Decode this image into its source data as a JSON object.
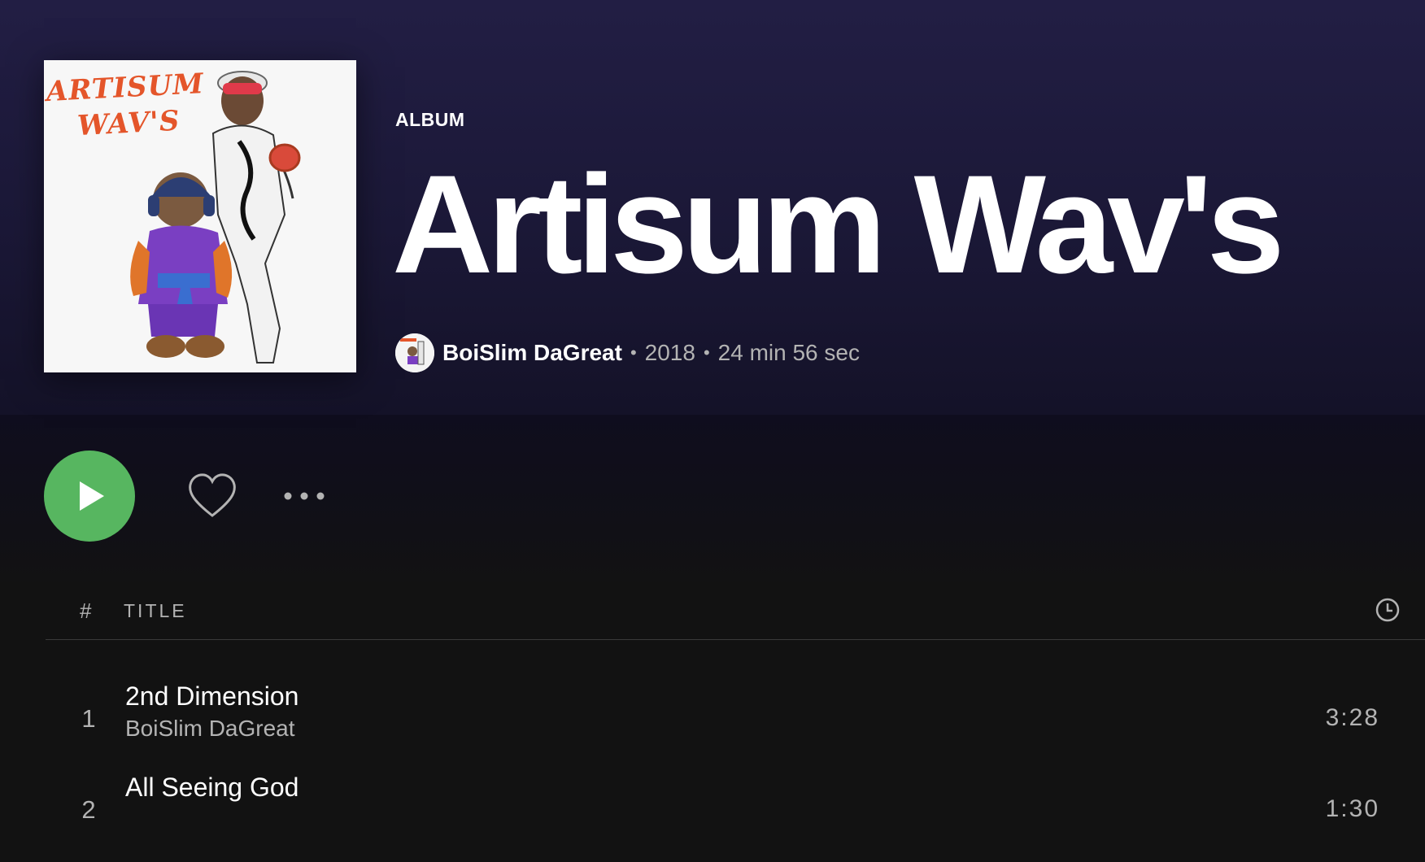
{
  "album": {
    "type_label": "ALBUM",
    "title": "Artisum Wav's",
    "artist": "BoiSlim DaGreat",
    "year": "2018",
    "duration": "24 min 56 sec",
    "cover_text_line1": "ARTISUM",
    "cover_text_line2": "WAV'S"
  },
  "actions": {
    "play_icon": "play-icon",
    "like_icon": "heart-icon",
    "more_icon": "more-horizontal-icon"
  },
  "tracklist": {
    "header_number": "#",
    "header_title": "TITLE",
    "header_duration_icon": "clock-icon",
    "tracks": [
      {
        "number": "1",
        "title": "2nd Dimension",
        "artist": "BoiSlim DaGreat",
        "duration": "3:28"
      },
      {
        "number": "2",
        "title": "All Seeing God",
        "artist": "",
        "duration": "1:30"
      }
    ]
  },
  "colors": {
    "header_bg": "#221e44",
    "page_bg": "#121212",
    "accent_green": "#57b660",
    "muted_text": "#b3b3b3",
    "cover_text": "#e4552a"
  }
}
